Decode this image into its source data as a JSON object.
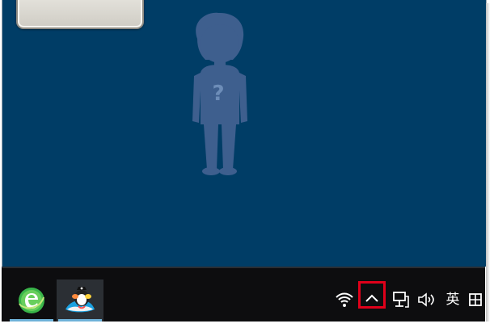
{
  "desktop": {
    "background_color": "#003d66",
    "gadget": {
      "name": "desktop-gadget"
    },
    "avatar": {
      "glyph": "?",
      "color": "#3e5f8e"
    }
  },
  "taskbar": {
    "pinned_apps": [
      {
        "icon": "browser-e-icon",
        "color": "#39b54a"
      },
      {
        "icon": "qq-penguin-icon",
        "color": "#1aa1e1"
      }
    ],
    "tray": {
      "wifi_icon": "wifi-icon",
      "show_hidden_icons": "chevron-up-icon",
      "network_icon": "network-icon",
      "volume_icon": "speaker-icon",
      "input_language": "英",
      "ime_icon": "ime-mode-icon"
    },
    "highlight_color": "#e0001a"
  }
}
